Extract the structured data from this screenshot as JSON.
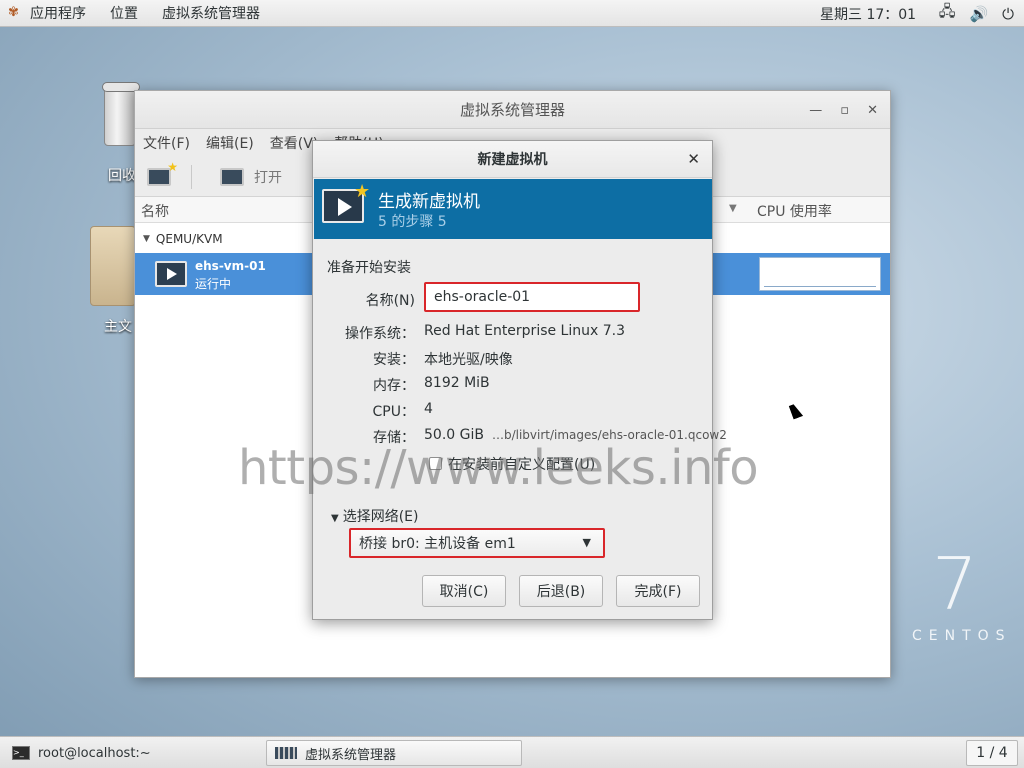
{
  "topbar": {
    "apps_label": "应用程序",
    "places_label": "位置",
    "app_label": "虚拟系统管理器",
    "clock": "星期三 17：01",
    "tray_icons": [
      "network-icon",
      "volume-icon",
      "power-icon"
    ]
  },
  "desktop": {
    "trash_label": "回收",
    "home_label": "主文",
    "centos_seven": "7",
    "centos_word": "CENTOS"
  },
  "main_window": {
    "title": "虚拟系统管理器",
    "menu": [
      "文件(F)",
      "编辑(E)",
      "查看(V)",
      "帮助(H)"
    ],
    "toolbar_open": "打开",
    "col_name": "名称",
    "col_cpu": "CPU 使用率",
    "group": "QEMU/KVM",
    "vm": {
      "name": "ehs-vm-01",
      "status": "运行中"
    }
  },
  "dialog": {
    "title": "新建虚拟机",
    "banner_title": "生成新虚拟机",
    "banner_step": "5 的步骤 5",
    "ready_label": "准备开始安装",
    "name_label": "名称(N)",
    "name_value": "ehs-oracle-01",
    "os_label": "操作系统：",
    "os_value": "Red Hat Enterprise Linux 7.3",
    "install_label": "安装：",
    "install_value": "本地光驱/映像",
    "memory_label": "内存：",
    "memory_value": "8192 MiB",
    "cpu_label": "CPU：",
    "cpu_value": "4",
    "storage_label": "存储：",
    "storage_value": "50.0 GiB",
    "storage_path": "…b/libvirt/images/ehs-oracle-01.qcow2",
    "customize_label": "在安装前自定义配置(U)",
    "network_expander": "选择网络(E)",
    "network_value": "桥接 br0: 主机设备 em1",
    "btn_cancel": "取消(C)",
    "btn_back": "后退(B)",
    "btn_finish": "完成(F)"
  },
  "watermark": "https://www.leeks.info",
  "taskbar": {
    "terminal": "root@localhost:~",
    "virt_manager": "虚拟系统管理器",
    "workspace": "1 / 4"
  }
}
